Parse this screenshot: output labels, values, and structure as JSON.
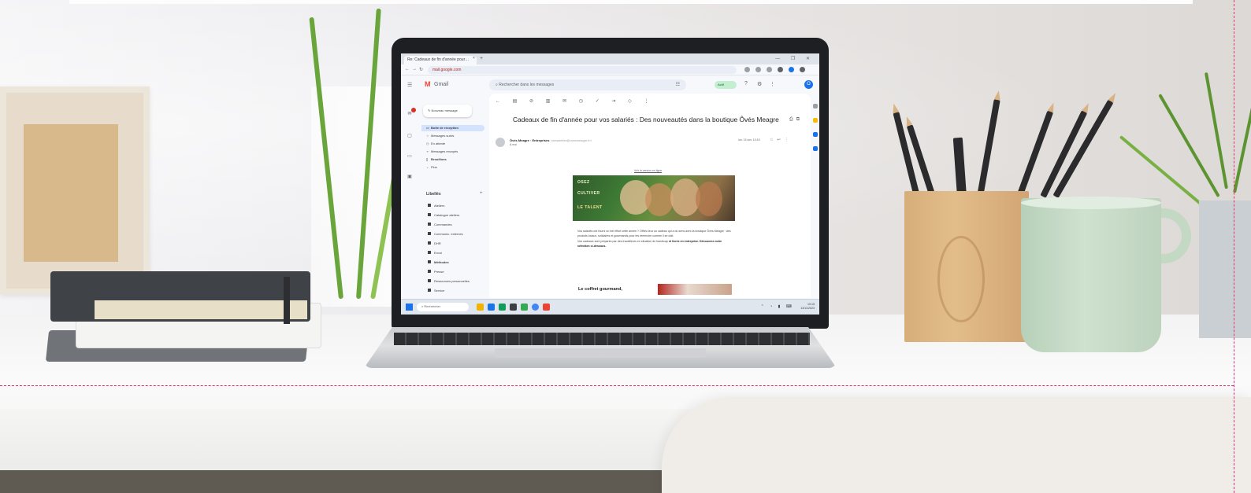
{
  "browser": {
    "tab_title": "Re: Cadeaux de fin d'année pour…",
    "tab_close": "×",
    "new_tab": "+",
    "window_controls": "—  ❐  ✕",
    "url": "mail.google.com",
    "nav": {
      "back": "←",
      "forward": "→",
      "reload": "↻"
    }
  },
  "gmail": {
    "app_name": "Gmail",
    "logo_letter": "M",
    "search_placeholder": "Rechercher dans les messages",
    "status": "Actif",
    "avatar_initial": "O",
    "compose_label": "Nouveau message",
    "nav": [
      {
        "label": "Boîte de réception",
        "icon": "inbox-icon",
        "glyph": "▭",
        "active": true
      },
      {
        "label": "Messages suivis",
        "icon": "star-icon",
        "glyph": "☆",
        "active": false
      },
      {
        "label": "En attente",
        "icon": "clock-icon",
        "glyph": "◷",
        "active": false
      },
      {
        "label": "Messages envoyés",
        "icon": "send-icon",
        "glyph": "➢",
        "active": false
      },
      {
        "label": "Brouillons",
        "icon": "draft-icon",
        "glyph": "▯",
        "active": false
      },
      {
        "label": "Plus",
        "icon": "chevron-down-icon",
        "glyph": "⌄",
        "active": false
      }
    ],
    "labels_heading": "Libellés",
    "labels": [
      "Ateliers",
      "Catalogue ateliers",
      "Commandes",
      "Communic. externes",
      "DHR",
      "Envoi",
      "Méthodes",
      "Presse",
      "Ressources personnelles",
      "Service"
    ],
    "rail": [
      "Mail",
      "Chat",
      "Meet",
      "Spaces"
    ],
    "email": {
      "subject": "Cadeaux de fin d'année pour vos salariés : Des nouveautés dans la boutique Ôvés Meagre",
      "sender_name": "Ôvés Meagre · Entreprises",
      "sender_detail": "<newsletter@ovesmeagre.fr>",
      "to_line": "À moi",
      "date": "lun. 13 nov. 10:15",
      "view_online": "Voir la version en ligne",
      "banner_lines": [
        "OSEZ",
        "CULTIVER",
        "LE TALENT"
      ],
      "body_html_parts": [
        "Vos salariés ont fourni un bel effort cette année ? Offrez-leur un cadeau qui a du sens avec la boutique Ôvés Meagre : des produits locaux, solidaires et gourmands pour les remercier comme il se doit.",
        "Vos cadeaux sont préparés par des travailleurs en situation de handicap",
        "et livrés en entreprise. Découvrez notre sélection ci-dessous."
      ],
      "promo_title": "Le coffret gourmand,"
    }
  },
  "taskbar": {
    "search_placeholder": "Rechercher",
    "clock_time": "10:15",
    "clock_date": "13/11/2023",
    "tray": "⌃ ◔ ▮ ⌨"
  },
  "colors": {
    "gmail_red": "#ea4335",
    "active_nav": "#d3e3fd",
    "guide_dash": "#e0307a"
  }
}
